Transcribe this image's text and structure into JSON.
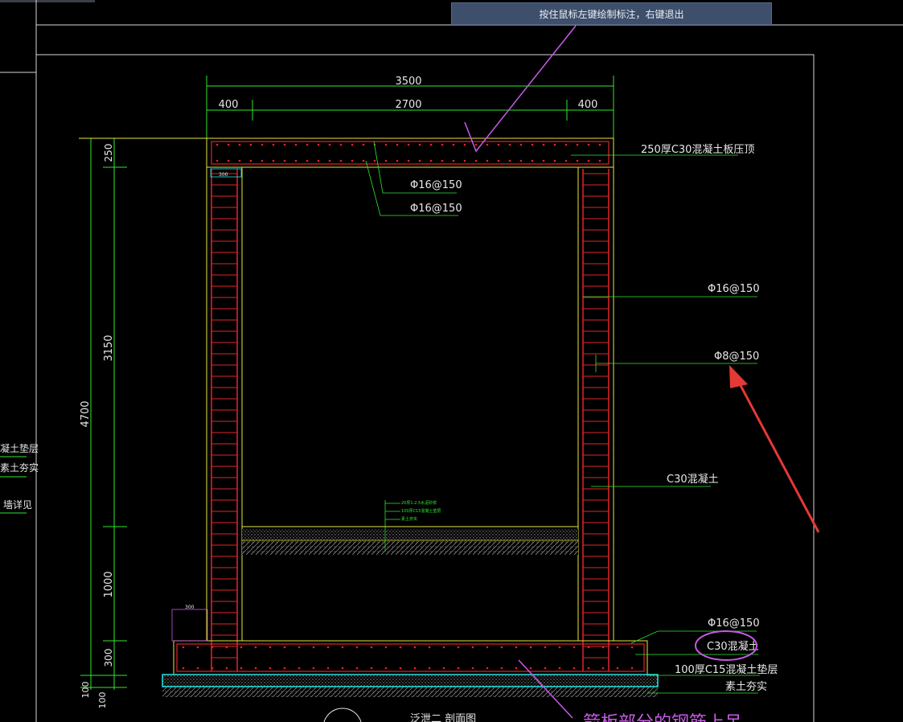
{
  "tooltip": {
    "text": "按住鼠标左键绘制标注，右键退出"
  },
  "dimensions": {
    "total_width": "3500",
    "left_wall": "400",
    "clear_span": "2700",
    "right_wall": "400",
    "total_height": "4700",
    "roof_thickness": "250",
    "wall_height": "3150",
    "lower_height": "1000",
    "base_thickness": "300",
    "cushion_1": "100",
    "cushion_2": "100",
    "small_dim_1": "300",
    "small_dim_2": "300"
  },
  "labels": {
    "roof_slab": "250厚C30混凝土板压顶",
    "roof_rebar_1": "Φ16@150",
    "roof_rebar_2": "Φ16@150",
    "wall_rebar_main": "Φ16@150",
    "wall_rebar_dist": "Φ8@150",
    "wall_concrete": "C30混凝土",
    "base_rebar": "Φ16@150",
    "base_concrete": "C30混凝土",
    "cushion": "100厚C15混凝土垫层",
    "soil": "素土夯实",
    "floor_note_1": "20厚1:2.5水泥砂浆",
    "floor_note_2": "100厚C15混凝土垫层",
    "floor_note_3": "素土夯实",
    "section_title": "泛泄二 剖面图",
    "handwritten": "箭板部分的钢筋上吊"
  },
  "left_cut_labels": [
    "凝土垫层",
    "素土夯实",
    "墙详见"
  ],
  "colors": {
    "background": "#000000",
    "dim_green": "#2fe82f",
    "wall_red": "#e0262a",
    "outline_yellow": "#e6e640",
    "annotation_magenta": "#c85ae6",
    "arrow_red": "#e53935",
    "cushion_cyan": "#26e6e6",
    "text_white": "#e8e8e8"
  }
}
